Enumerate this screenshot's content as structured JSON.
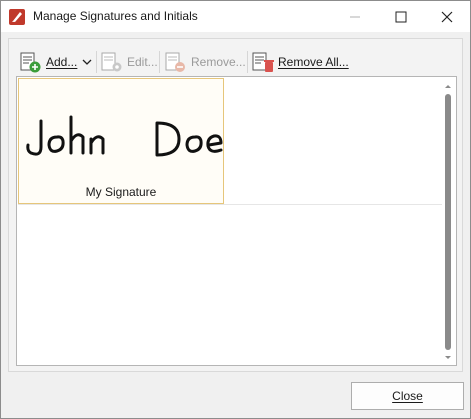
{
  "window": {
    "title": "Manage Signatures and Initials"
  },
  "toolbar": {
    "add_label": "Add...",
    "edit_label": "Edit...",
    "remove_label": "Remove...",
    "remove_all_label": "Remove All..."
  },
  "signatures": [
    {
      "script_text": "John Doe",
      "caption": "My Signature"
    }
  ],
  "footer": {
    "close_label": "Close"
  },
  "colors": {
    "accent": "#e6c67a",
    "app_icon": "#c0392b"
  },
  "icons": [
    "app-logo-icon",
    "minimize-icon",
    "maximize-icon",
    "close-icon",
    "add-signature-icon",
    "dropdown-arrow-icon",
    "edit-signature-icon",
    "remove-signature-icon",
    "remove-all-icon"
  ]
}
